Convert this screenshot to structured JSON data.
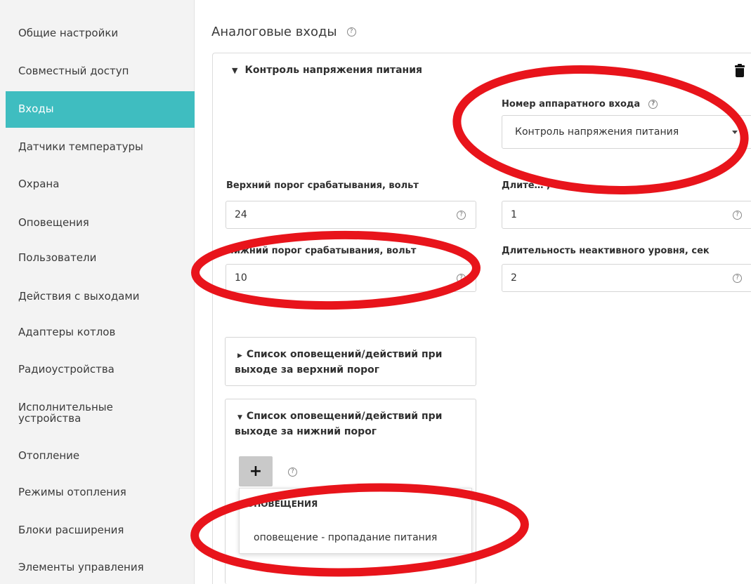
{
  "sidebar": {
    "items": [
      {
        "label": "Общие настройки"
      },
      {
        "label": "Совместный доступ"
      },
      {
        "label": "Входы"
      },
      {
        "label": "Датчики температуры"
      },
      {
        "label": "Охрана"
      },
      {
        "label": "Оповещения"
      },
      {
        "label": "Пользователи"
      },
      {
        "label": "Действия с выходами"
      },
      {
        "label": "Адаптеры котлов"
      },
      {
        "label": "Радиоустройства"
      },
      {
        "label": "Исполнительные устройства"
      },
      {
        "label": "Отопление"
      },
      {
        "label": "Режимы отопления"
      },
      {
        "label": "Блоки расширения"
      },
      {
        "label": "Элементы управления"
      }
    ],
    "active": "Входы"
  },
  "page": {
    "title": "Аналоговые входы",
    "help_glyph": "?"
  },
  "input_block": {
    "title": "Контроль напряжения питания",
    "hardware_input": {
      "label": "Номер аппаратного входа",
      "value": "Контроль напряжения питания"
    },
    "upper_threshold": {
      "label": "Верхний порог срабатывания, вольт",
      "value": "24"
    },
    "lower_threshold": {
      "label": "Нижний порог срабатывания, вольт",
      "value": "10"
    },
    "active_duration": {
      "label": "Длите…                                , сек",
      "value": "1"
    },
    "inactive_duration": {
      "label": "Длительность неактивного уровня, сек",
      "value": "2"
    },
    "upper_list": {
      "title": "Список оповещений/действий при выходе за верхний порог",
      "expanded": false
    },
    "lower_list": {
      "title": "Список оповещений/действий при выходе за нижний порог",
      "expanded": true
    },
    "add_button": "+",
    "dropdown": {
      "group": "ОПОВЕЩЕНИЯ",
      "items": [
        "оповещение - пропадание питания"
      ]
    }
  },
  "annotations": {
    "color": "#e8141b"
  }
}
